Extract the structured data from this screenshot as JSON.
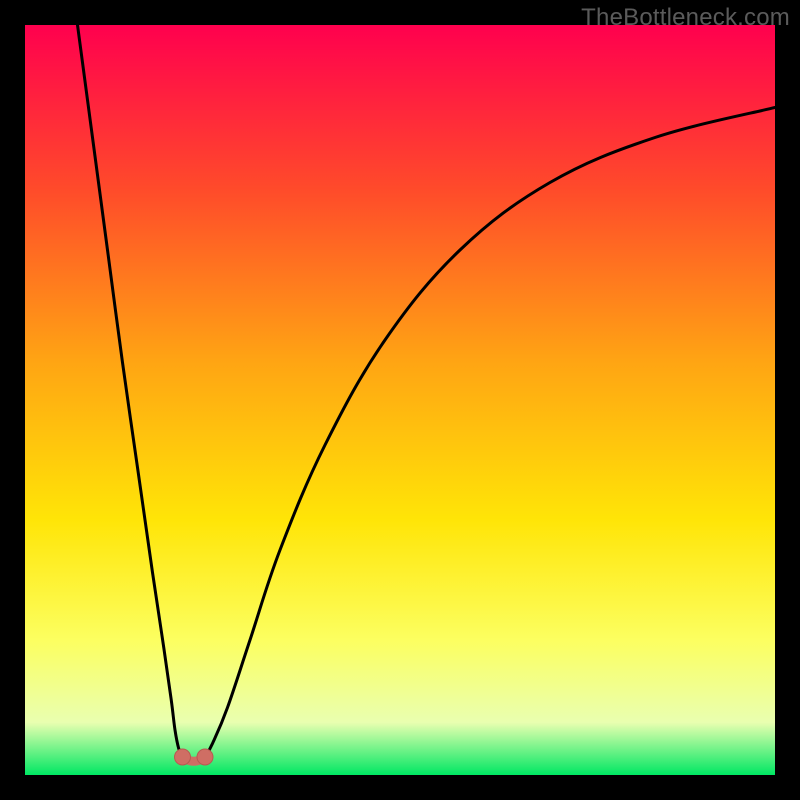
{
  "watermark": "TheBottleneck.com",
  "colors": {
    "gradient_top": "#ff004e",
    "gradient_mid1": "#ff4b2a",
    "gradient_mid2": "#ffa513",
    "gradient_mid3": "#ffe507",
    "gradient_mid4": "#fcff60",
    "gradient_mid5": "#e9ffb0",
    "gradient_bottom": "#00e763",
    "curve": "#000000",
    "marker_fill": "#cf6e64",
    "marker_stroke": "#b85a51"
  },
  "chart_data": {
    "type": "line",
    "title": "",
    "xlabel": "",
    "ylabel": "",
    "xlim": [
      0,
      100
    ],
    "ylim": [
      0,
      100
    ],
    "series": [
      {
        "name": "left-branch",
        "x": [
          7,
          9,
          11,
          13,
          15,
          17,
          18.5,
          19.5,
          20,
          20.5,
          21
        ],
        "y": [
          100,
          85,
          70,
          55,
          41,
          27,
          17,
          10,
          6,
          3.5,
          2.4
        ]
      },
      {
        "name": "min-floor",
        "x": [
          21,
          22,
          23,
          24
        ],
        "y": [
          2.4,
          1.9,
          1.9,
          2.4
        ]
      },
      {
        "name": "right-branch",
        "x": [
          24,
          25,
          27,
          30,
          34,
          40,
          48,
          58,
          70,
          84,
          100
        ],
        "y": [
          2.4,
          4.2,
          9,
          18,
          30,
          44,
          58,
          70,
          79,
          85,
          89
        ]
      }
    ],
    "markers": [
      {
        "x": 21,
        "y": 2.4
      },
      {
        "x": 24,
        "y": 2.4
      }
    ]
  }
}
